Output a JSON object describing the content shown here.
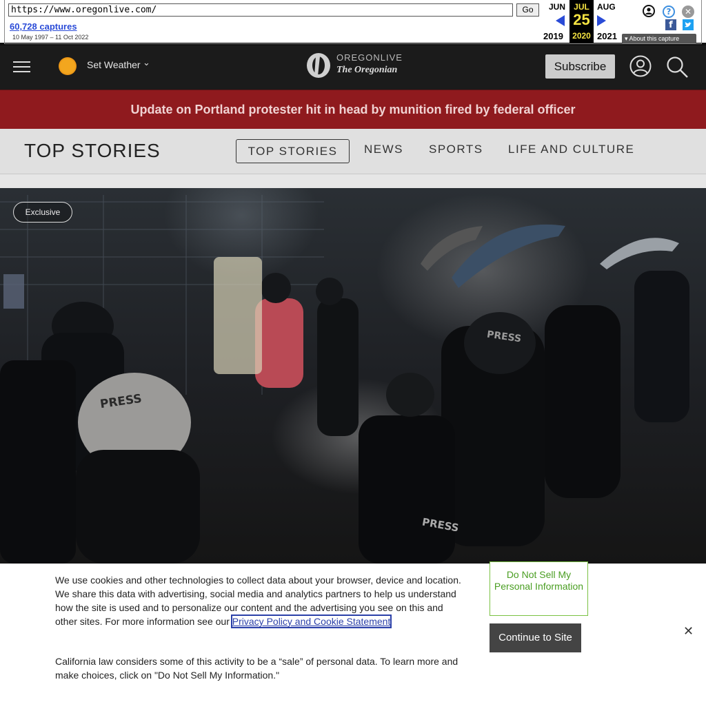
{
  "wayback": {
    "url": "https://www.oregonlive.com/",
    "go_label": "Go",
    "captures": "60,728 captures",
    "date_range": "10 May 1997 – 11 Oct 2022",
    "months": {
      "prev": "JUN",
      "current": "JUL",
      "next": "AUG"
    },
    "day": "25",
    "years": {
      "prev": "2019",
      "current": "2020",
      "next": "2021"
    },
    "about": "About this capture"
  },
  "header": {
    "weather_label": "Set Weather",
    "logo_top": "OREGONLIVE",
    "logo_sub": "The Oregonian",
    "subscribe_label": "Subscribe"
  },
  "breaking": {
    "headline": "Update on Portland protester hit in head by munition fired by federal officer"
  },
  "section": {
    "title": "TOP STORIES",
    "tabs": [
      "TOP STORIES",
      "NEWS",
      "SPORTS",
      "LIFE AND CULTURE"
    ]
  },
  "hero": {
    "badge": "Exclusive",
    "helmet_text_1": "PRESS",
    "helmet_text_2": "PRESS",
    "bag_text": "PRESS"
  },
  "cookie": {
    "text_before_link": "We use cookies and other technologies to collect data about your browser, device and location. We share this data with advertising, social media and analytics partners to help us understand how the site is used and to personalize our content and the advertising you see on this and other sites. For more information see our ",
    "link_text": "Privacy Policy and Cookie Statement",
    "california_text": "California law considers some of this activity to be a “sale” of personal data. To learn more and make choices, click on \"Do Not Sell My Information.\"",
    "do_not_sell_label": "Do Not Sell My Personal Information",
    "continue_label": "Continue to Site",
    "close_symbol": "✕"
  },
  "colors": {
    "banner": "#8f1a1e",
    "header": "#1b1b1b",
    "dns_green": "#4a9e22",
    "wayback_link": "#2a4bd7"
  }
}
